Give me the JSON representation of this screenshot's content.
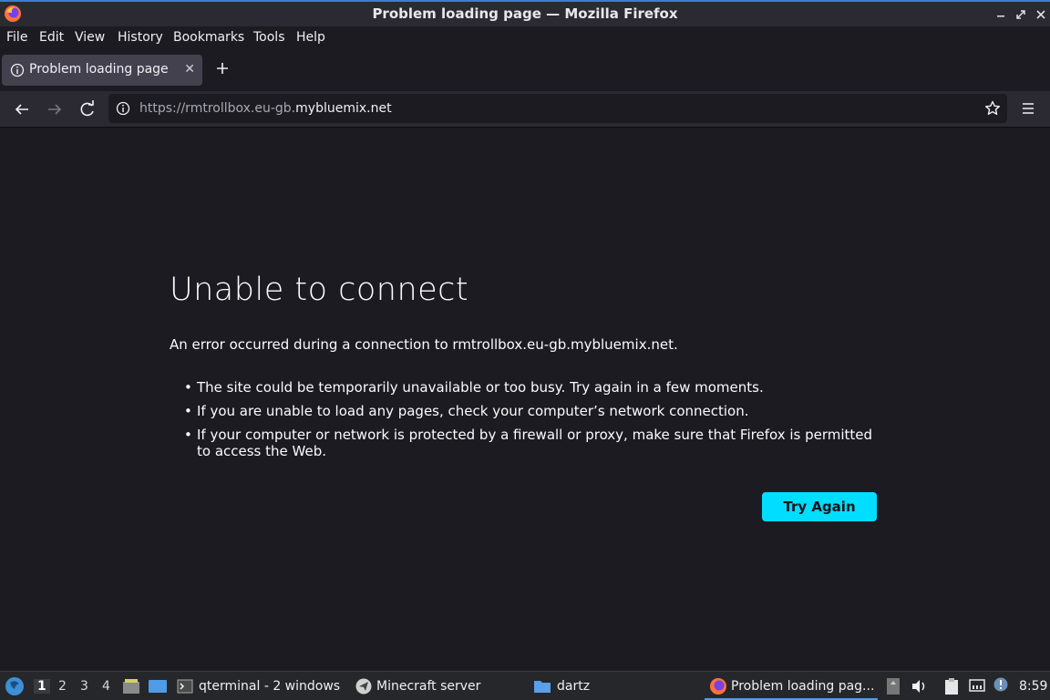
{
  "window": {
    "title": "Problem loading page — Mozilla Firefox",
    "controls": [
      "minimize",
      "maximize",
      "close"
    ]
  },
  "menubar": {
    "items": [
      "File",
      "Edit",
      "View",
      "History",
      "Bookmarks",
      "Tools",
      "Help"
    ]
  },
  "tabs": [
    {
      "label": "Problem loading page",
      "icon": "info-icon"
    }
  ],
  "newtab": {
    "label": "+"
  },
  "urlbar": {
    "url_prefix": "https://rmtrollbox.eu-gb.",
    "url_domain": "mybluemix.net"
  },
  "error": {
    "title": "Unable to connect",
    "description": "An error occurred during a connection to rmtrollbox.eu-gb.mybluemix.net.",
    "items": [
      "The site could be temporarily unavailable or too busy. Try again in a few moments.",
      "If you are unable to load any pages, check your computer’s network connection.",
      "If your computer or network is protected by a firewall or proxy, make sure that Firefox is permitted to access the Web."
    ],
    "button_label": "Try Again"
  },
  "taskbar": {
    "desktops": [
      "1",
      "2",
      "3",
      "4"
    ],
    "active_desktop": "1",
    "windows": [
      "qterminal - 2 windows",
      "Minecraft server",
      "dartz",
      "Problem loading pag..."
    ],
    "clock": "8:59"
  },
  "colors": {
    "accent_button": "#00ddff",
    "background": "#1c1b22",
    "toolbar": "#2b2a33"
  }
}
